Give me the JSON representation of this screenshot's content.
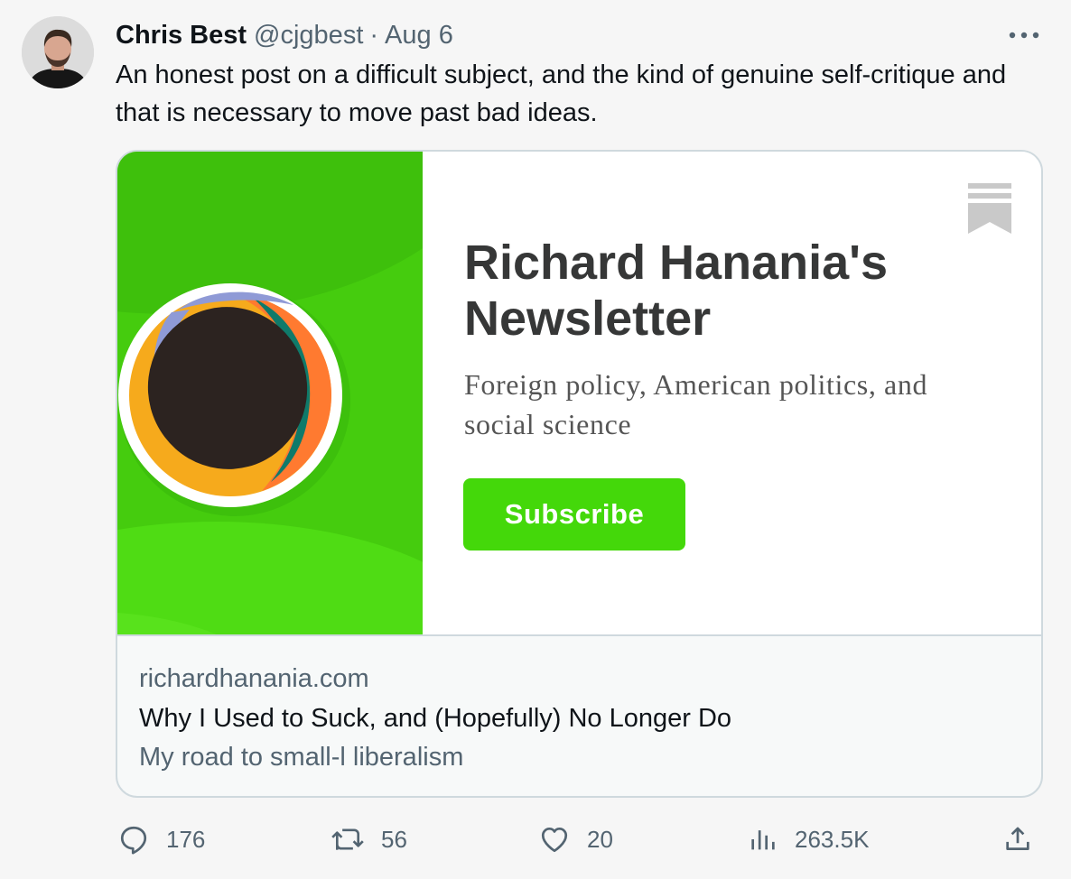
{
  "author": {
    "name": "Chris Best",
    "handle": "@cjgbest",
    "separator": "·",
    "date": "Aug 6"
  },
  "tweet": {
    "text": "An honest post on a difficult subject, and the kind of genuine self-critique and that is necessary to move past bad ideas."
  },
  "card": {
    "newsletter_title": "Richard Hanania's Newsletter",
    "newsletter_description": "Foreign policy, American politics, and social science",
    "subscribe_label": "Subscribe",
    "domain": "richardhanania.com",
    "title": "Why I Used to Suck, and (Hopefully) No Longer Do",
    "subtitle": "My road to small-l liberalism"
  },
  "metrics": {
    "replies": "176",
    "retweets": "56",
    "likes": "20",
    "views": "263.5K"
  },
  "icons": {
    "more": "more-horizontal-icon",
    "reply": "reply-icon",
    "retweet": "retweet-icon",
    "like": "heart-icon",
    "views": "views-chart-icon",
    "share": "share-icon",
    "bookmark": "bookmark-icon"
  },
  "colors": {
    "text_primary": "#0f1419",
    "text_secondary": "#536471",
    "card_border": "#cfd9de",
    "brand_green": "#44d80a"
  }
}
